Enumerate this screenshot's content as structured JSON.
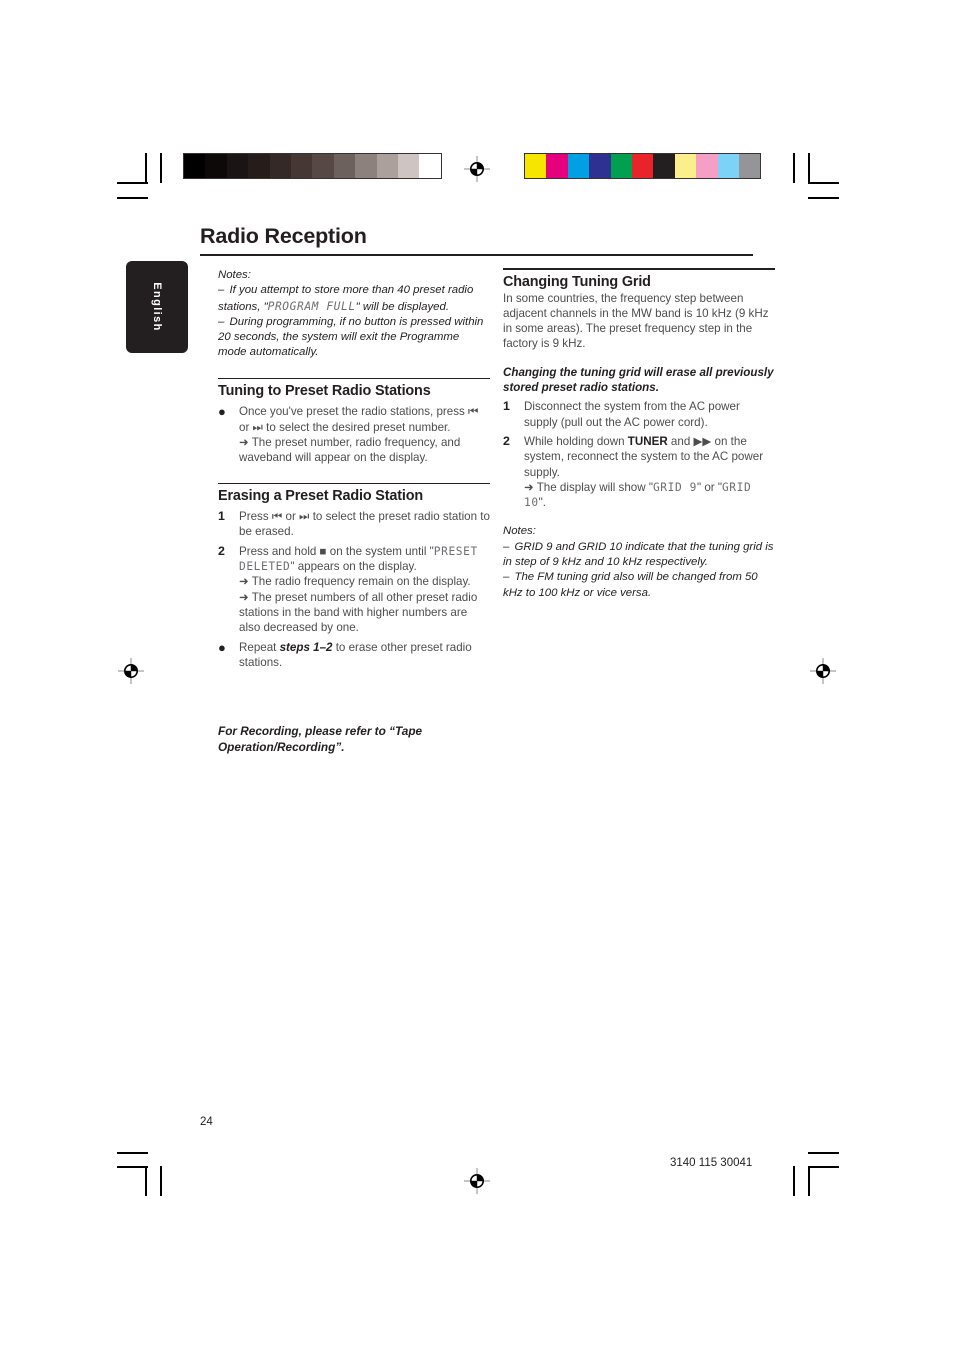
{
  "document": {
    "title": "Radio Reception",
    "language_tab": "English",
    "page_number": "24",
    "doc_code": "3140 115 30041"
  },
  "calibration": {
    "grayscale_swatches": [
      "#000000",
      "#0d0909",
      "#1b1414",
      "#261d1b",
      "#342926",
      "#453834",
      "#564945",
      "#6d615e",
      "#8d817e",
      "#aba09c",
      "#cec4c1",
      "#ffffff"
    ],
    "color_swatches": [
      "#f6e500",
      "#e5007d",
      "#00a0e3",
      "#2e3191",
      "#00a050",
      "#e8232a",
      "#231f20",
      "#fbef8b",
      "#f59fc7",
      "#7dd2f7",
      "#939598"
    ]
  },
  "left_column": {
    "notes_label": "Notes:",
    "notes": [
      {
        "dash": "–",
        "parts": [
          {
            "type": "text",
            "value": "If you attempt to store more than 40 preset radio stations, \""
          },
          {
            "type": "lcd",
            "value": "PROGRAM FULL"
          },
          {
            "type": "text",
            "value": "\" will be displayed."
          }
        ]
      },
      {
        "dash": "–",
        "parts": [
          {
            "type": "text",
            "value": "During programming, if no button is pressed within 20 seconds, the system will exit the Programme mode automatically."
          }
        ]
      }
    ],
    "section1": {
      "heading": "Tuning to Preset Radio Stations",
      "items": [
        {
          "marker": "●",
          "lines": [
            "Once you've preset the radio stations, press ⏮ or ⏭ to select the desired preset number.",
            "➜ The preset number, radio frequency, and waveband will appear on the display."
          ]
        }
      ]
    },
    "section2": {
      "heading": "Erasing a Preset Radio Station",
      "items": [
        {
          "marker": "1",
          "text": "Press ⏮ or ⏭ to select the preset radio station to be erased."
        },
        {
          "marker": "2",
          "text_pre": "Press and hold ■ on the system until \"",
          "lcd": "PRESET DELETED",
          "text_post": "\" appears on the display.",
          "arrows": [
            "➜ The radio frequency remain on the display.",
            "➜ The preset numbers of all other preset radio stations in the band with higher numbers are also decreased by one."
          ]
        },
        {
          "marker": "●",
          "text_pre": "Repeat ",
          "bold_italic": "steps 1–2",
          "text_post": " to erase other preset radio stations."
        }
      ]
    },
    "callout": "For Recording, please refer to “Tape Operation/Recording”."
  },
  "right_column": {
    "section1": {
      "heading": "Changing Tuning Grid",
      "paragraph": "In some countries, the frequency step between adjacent channels in the MW band is 10 kHz (9 kHz in some areas). The preset frequency step in the factory is 9 kHz.",
      "warning": "Changing the tuning grid will erase all previously stored preset radio stations.",
      "steps": [
        {
          "marker": "1",
          "text": "Disconnect the system from the AC power supply (pull out the AC power cord)."
        },
        {
          "marker": "2",
          "text_pre": "While holding down ",
          "bold": "TUNER",
          "text_mid": " and ▶▶ on the system, reconnect the system to the AC power supply.",
          "arrow_pre": "➜ The display will show \"",
          "lcd1": "GRID 9",
          "arrow_mid": "\" or \"",
          "lcd2": "GRID 10",
          "arrow_post": "\"."
        }
      ]
    },
    "notes_label": "Notes:",
    "notes": [
      {
        "dash": "–",
        "text": "GRID 9 and GRID 10 indicate that the tuning grid is in step of 9 kHz and 10 kHz respectively."
      },
      {
        "dash": "–",
        "text": "The FM tuning grid also will be changed from 50 kHz to 100 kHz or vice versa."
      }
    ]
  }
}
